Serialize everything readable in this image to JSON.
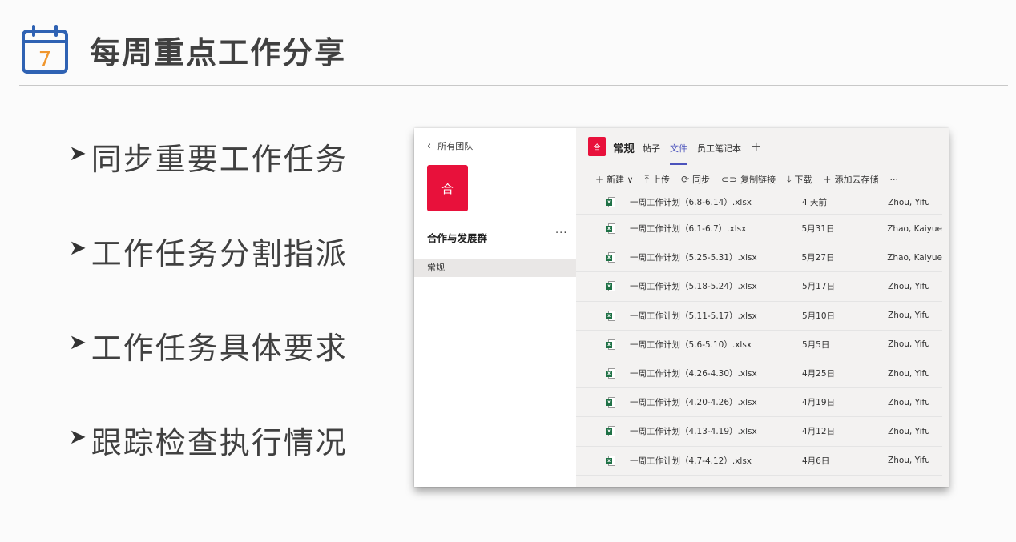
{
  "page": {
    "title": "每周重点工作分享",
    "calendar_number": "7",
    "accent_color": "#2f62b3",
    "number_color": "#f0962d"
  },
  "bullets": [
    {
      "text": "同步重要工作任务"
    },
    {
      "text": "工作任务分割指派"
    },
    {
      "text": "工作任务具体要求"
    },
    {
      "text": "跟踪检查执行情况"
    }
  ],
  "teams": {
    "back_label": "所有团队",
    "team_avatar": "合",
    "team_name": "合作与发展群",
    "team_more": "···",
    "channel": "常规",
    "channel_header": {
      "avatar": "合",
      "name": "常规",
      "tabs": [
        {
          "label": "帖子"
        },
        {
          "label": "文件",
          "active": true
        },
        {
          "label": "员工笔记本"
        }
      ],
      "add_tab": "+"
    },
    "toolbar": [
      {
        "icon": "+",
        "label": "新建 ∨"
      },
      {
        "icon": "⤒",
        "label": "上传"
      },
      {
        "icon": "⟳",
        "label": "同步"
      },
      {
        "icon": "⊂⊃",
        "label": "复制链接"
      },
      {
        "icon": "⤓",
        "label": "下载"
      },
      {
        "icon": "+",
        "label": "添加云存储"
      },
      {
        "icon": "",
        "label": "···"
      }
    ],
    "files": [
      {
        "name": "一周工作计划（6.8-6.14）.xlsx",
        "modified": "4 天前",
        "author": "Zhou, Yifu"
      },
      {
        "name": "一周工作计划（6.1-6.7）.xlsx",
        "modified": "5月31日",
        "author": "Zhao, Kaiyue"
      },
      {
        "name": "一周工作计划（5.25-5.31）.xlsx",
        "modified": "5月27日",
        "author": "Zhao, Kaiyue"
      },
      {
        "name": "一周工作计划（5.18-5.24）.xlsx",
        "modified": "5月17日",
        "author": "Zhou, Yifu"
      },
      {
        "name": "一周工作计划（5.11-5.17）.xlsx",
        "modified": "5月10日",
        "author": "Zhou, Yifu"
      },
      {
        "name": "一周工作计划（5.6-5.10）.xlsx",
        "modified": "5月5日",
        "author": "Zhou, Yifu"
      },
      {
        "name": "一周工作计划（4.26-4.30）.xlsx",
        "modified": "4月25日",
        "author": "Zhou, Yifu"
      },
      {
        "name": "一周工作计划（4.20-4.26）.xlsx",
        "modified": "4月19日",
        "author": "Zhou, Yifu"
      },
      {
        "name": "一周工作计划（4.13-4.19）.xlsx",
        "modified": "4月12日",
        "author": "Zhou, Yifu"
      },
      {
        "name": "一周工作计划（4.7-4.12）.xlsx",
        "modified": "4月6日",
        "author": "Zhou, Yifu"
      }
    ]
  }
}
